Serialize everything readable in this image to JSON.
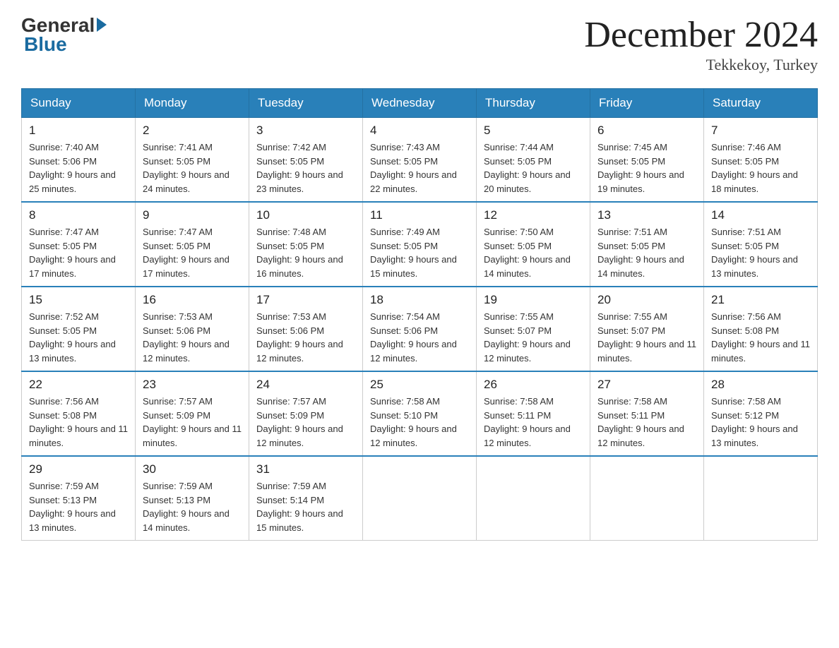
{
  "header": {
    "logo_general": "General",
    "logo_blue": "Blue",
    "month_title": "December 2024",
    "location": "Tekkekoy, Turkey"
  },
  "weekdays": [
    "Sunday",
    "Monday",
    "Tuesday",
    "Wednesday",
    "Thursday",
    "Friday",
    "Saturday"
  ],
  "weeks": [
    [
      {
        "day": "1",
        "sunrise": "7:40 AM",
        "sunset": "5:06 PM",
        "daylight": "9 hours and 25 minutes."
      },
      {
        "day": "2",
        "sunrise": "7:41 AM",
        "sunset": "5:05 PM",
        "daylight": "9 hours and 24 minutes."
      },
      {
        "day": "3",
        "sunrise": "7:42 AM",
        "sunset": "5:05 PM",
        "daylight": "9 hours and 23 minutes."
      },
      {
        "day": "4",
        "sunrise": "7:43 AM",
        "sunset": "5:05 PM",
        "daylight": "9 hours and 22 minutes."
      },
      {
        "day": "5",
        "sunrise": "7:44 AM",
        "sunset": "5:05 PM",
        "daylight": "9 hours and 20 minutes."
      },
      {
        "day": "6",
        "sunrise": "7:45 AM",
        "sunset": "5:05 PM",
        "daylight": "9 hours and 19 minutes."
      },
      {
        "day": "7",
        "sunrise": "7:46 AM",
        "sunset": "5:05 PM",
        "daylight": "9 hours and 18 minutes."
      }
    ],
    [
      {
        "day": "8",
        "sunrise": "7:47 AM",
        "sunset": "5:05 PM",
        "daylight": "9 hours and 17 minutes."
      },
      {
        "day": "9",
        "sunrise": "7:47 AM",
        "sunset": "5:05 PM",
        "daylight": "9 hours and 17 minutes."
      },
      {
        "day": "10",
        "sunrise": "7:48 AM",
        "sunset": "5:05 PM",
        "daylight": "9 hours and 16 minutes."
      },
      {
        "day": "11",
        "sunrise": "7:49 AM",
        "sunset": "5:05 PM",
        "daylight": "9 hours and 15 minutes."
      },
      {
        "day": "12",
        "sunrise": "7:50 AM",
        "sunset": "5:05 PM",
        "daylight": "9 hours and 14 minutes."
      },
      {
        "day": "13",
        "sunrise": "7:51 AM",
        "sunset": "5:05 PM",
        "daylight": "9 hours and 14 minutes."
      },
      {
        "day": "14",
        "sunrise": "7:51 AM",
        "sunset": "5:05 PM",
        "daylight": "9 hours and 13 minutes."
      }
    ],
    [
      {
        "day": "15",
        "sunrise": "7:52 AM",
        "sunset": "5:05 PM",
        "daylight": "9 hours and 13 minutes."
      },
      {
        "day": "16",
        "sunrise": "7:53 AM",
        "sunset": "5:06 PM",
        "daylight": "9 hours and 12 minutes."
      },
      {
        "day": "17",
        "sunrise": "7:53 AM",
        "sunset": "5:06 PM",
        "daylight": "9 hours and 12 minutes."
      },
      {
        "day": "18",
        "sunrise": "7:54 AM",
        "sunset": "5:06 PM",
        "daylight": "9 hours and 12 minutes."
      },
      {
        "day": "19",
        "sunrise": "7:55 AM",
        "sunset": "5:07 PM",
        "daylight": "9 hours and 12 minutes."
      },
      {
        "day": "20",
        "sunrise": "7:55 AM",
        "sunset": "5:07 PM",
        "daylight": "9 hours and 11 minutes."
      },
      {
        "day": "21",
        "sunrise": "7:56 AM",
        "sunset": "5:08 PM",
        "daylight": "9 hours and 11 minutes."
      }
    ],
    [
      {
        "day": "22",
        "sunrise": "7:56 AM",
        "sunset": "5:08 PM",
        "daylight": "9 hours and 11 minutes."
      },
      {
        "day": "23",
        "sunrise": "7:57 AM",
        "sunset": "5:09 PM",
        "daylight": "9 hours and 11 minutes."
      },
      {
        "day": "24",
        "sunrise": "7:57 AM",
        "sunset": "5:09 PM",
        "daylight": "9 hours and 12 minutes."
      },
      {
        "day": "25",
        "sunrise": "7:58 AM",
        "sunset": "5:10 PM",
        "daylight": "9 hours and 12 minutes."
      },
      {
        "day": "26",
        "sunrise": "7:58 AM",
        "sunset": "5:11 PM",
        "daylight": "9 hours and 12 minutes."
      },
      {
        "day": "27",
        "sunrise": "7:58 AM",
        "sunset": "5:11 PM",
        "daylight": "9 hours and 12 minutes."
      },
      {
        "day": "28",
        "sunrise": "7:58 AM",
        "sunset": "5:12 PM",
        "daylight": "9 hours and 13 minutes."
      }
    ],
    [
      {
        "day": "29",
        "sunrise": "7:59 AM",
        "sunset": "5:13 PM",
        "daylight": "9 hours and 13 minutes."
      },
      {
        "day": "30",
        "sunrise": "7:59 AM",
        "sunset": "5:13 PM",
        "daylight": "9 hours and 14 minutes."
      },
      {
        "day": "31",
        "sunrise": "7:59 AM",
        "sunset": "5:14 PM",
        "daylight": "9 hours and 15 minutes."
      },
      null,
      null,
      null,
      null
    ]
  ],
  "labels": {
    "sunrise": "Sunrise:",
    "sunset": "Sunset:",
    "daylight": "Daylight:"
  }
}
